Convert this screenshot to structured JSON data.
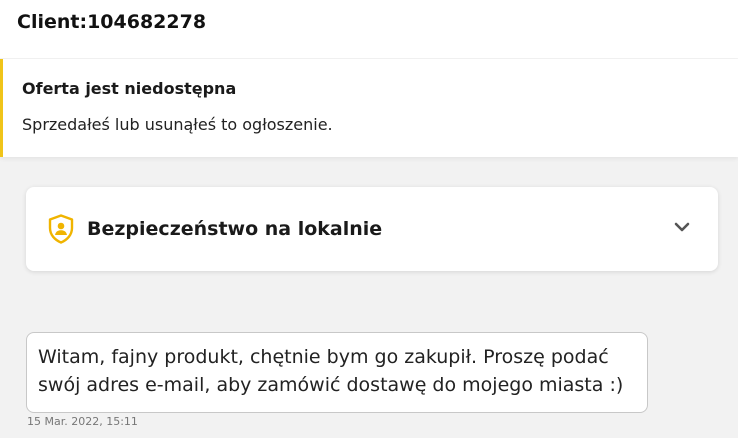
{
  "header": {
    "title": "Client:104682278"
  },
  "notice": {
    "title": "Oferta jest niedostępna",
    "text": "Sprzedałeś lub usunąłeś to ogłoszenie.",
    "accent_color": "#f0c419"
  },
  "safety": {
    "label": "Bezpieczeństwo na lokalnie",
    "icon": "shield-user-icon",
    "icon_color": "#f0b400",
    "expand_icon": "chevron-down-icon"
  },
  "message": {
    "text": "Witam, fajny produkt, chętnie bym go zakupił. Proszę podać swój adres e-mail, aby zamówić dostawę do mojego miasta :)",
    "timestamp": "15 Mar. 2022, 15:11"
  }
}
